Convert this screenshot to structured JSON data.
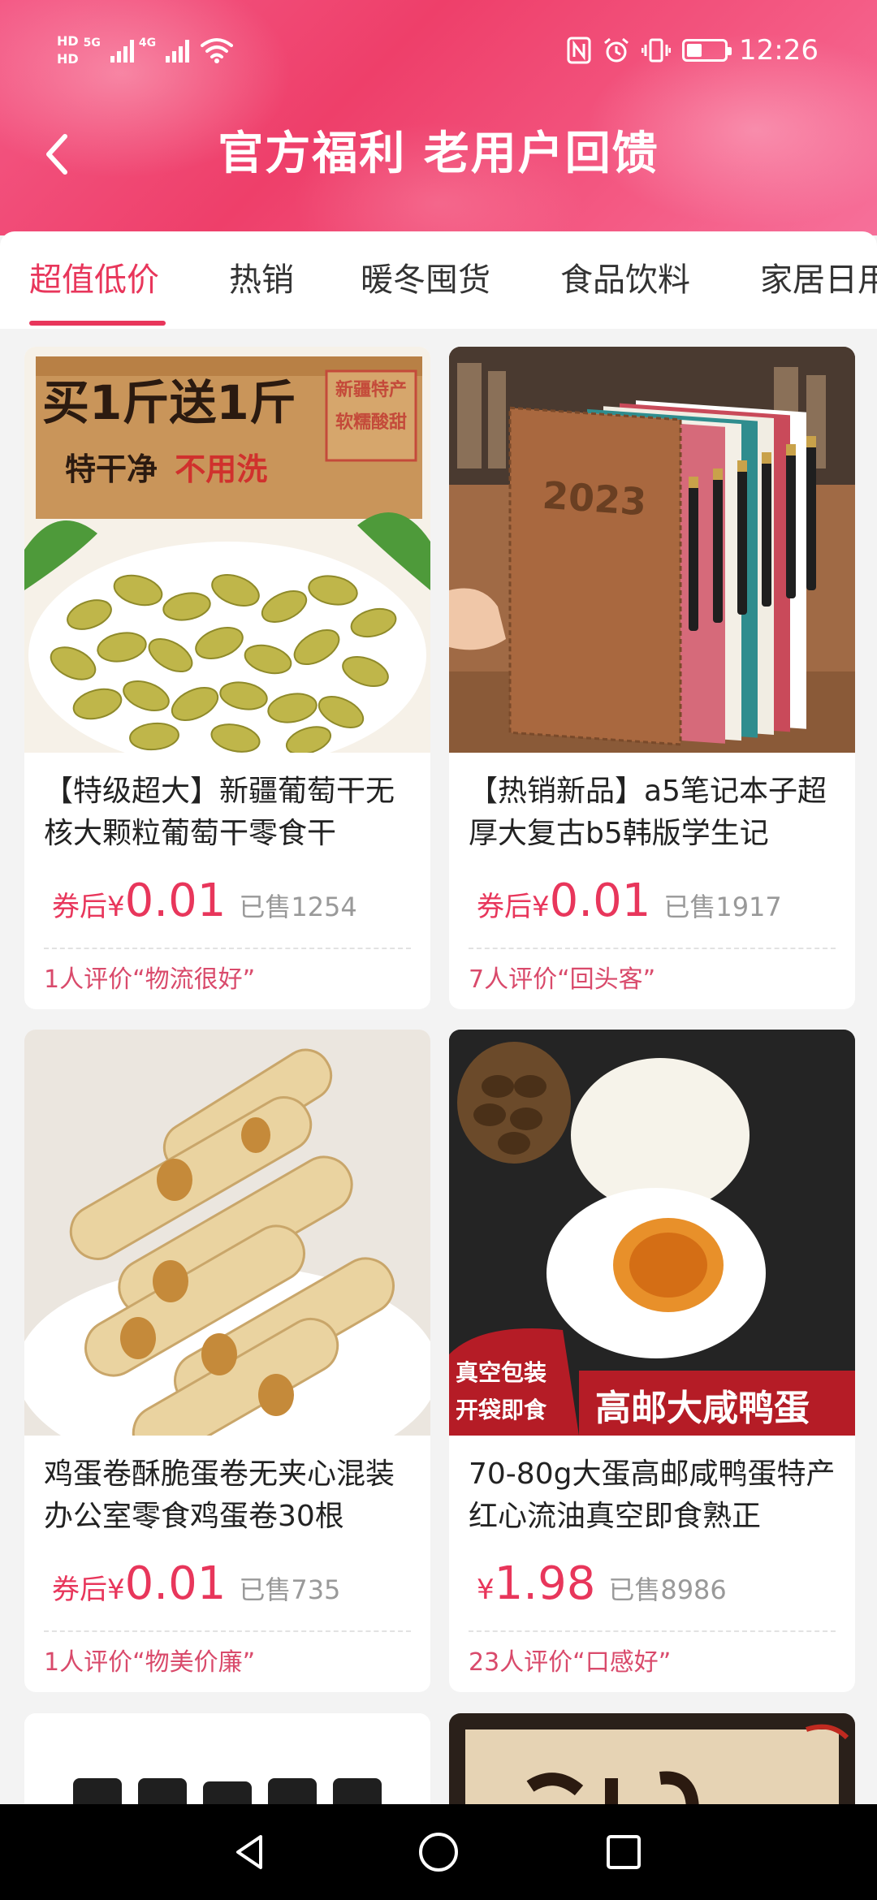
{
  "status_bar": {
    "hd_top": "HD",
    "hd_bottom": "HD",
    "net1": "5G",
    "net2": "4G",
    "time": "12:26",
    "battery_level": 0.4
  },
  "header": {
    "title": "官方福利 老用户回馈"
  },
  "tabs": [
    {
      "label": "超值低价",
      "active": true
    },
    {
      "label": "热销",
      "active": false
    },
    {
      "label": "暖冬囤货",
      "active": false
    },
    {
      "label": "食品饮料",
      "active": false
    },
    {
      "label": "家居日用",
      "active": false
    }
  ],
  "products": [
    {
      "title": "【特级超大】新疆葡萄干无核大颗粒葡萄干零食干",
      "price_prefix": "券后¥",
      "price": "0.01",
      "sold": "已售1254",
      "review": "1人评价“物流很好”",
      "image": {
        "name": "raisins-product-image",
        "headline": "买1斤送1斤",
        "subline": "特干净",
        "subline_red": "不用洗",
        "tag_line1": "新疆特产",
        "tag_line2": "软糯酸甜"
      }
    },
    {
      "title": "【热销新品】a5笔记本子超厚大复古b5韩版学生记",
      "price_prefix": "券后¥",
      "price": "0.01",
      "sold": "已售1917",
      "review": "7人评价“回头客”",
      "image": {
        "name": "notebook-product-image",
        "year": "2023"
      }
    },
    {
      "title": "鸡蛋卷酥脆蛋卷无夹心混装办公室零食鸡蛋卷30根",
      "price_prefix": "券后¥",
      "price": "0.01",
      "sold": "已售735",
      "review": "1人评价“物美价廉”",
      "image": {
        "name": "egg-roll-product-image"
      }
    },
    {
      "title": "70-80g大蛋高邮咸鸭蛋特产红心流油真空即食熟正",
      "price_prefix": "¥",
      "price": "1.98",
      "sold": "已售8986",
      "review": "23人评价“口感好”",
      "image": {
        "name": "salted-duck-egg-product-image",
        "badge_line1": "真空包装",
        "badge_line2": "开袋即食",
        "banner": "高邮大咸鸭蛋"
      }
    }
  ],
  "colors": {
    "accent": "#e8365b",
    "header_start": "#f45a86",
    "header_end": "#f6709a"
  }
}
